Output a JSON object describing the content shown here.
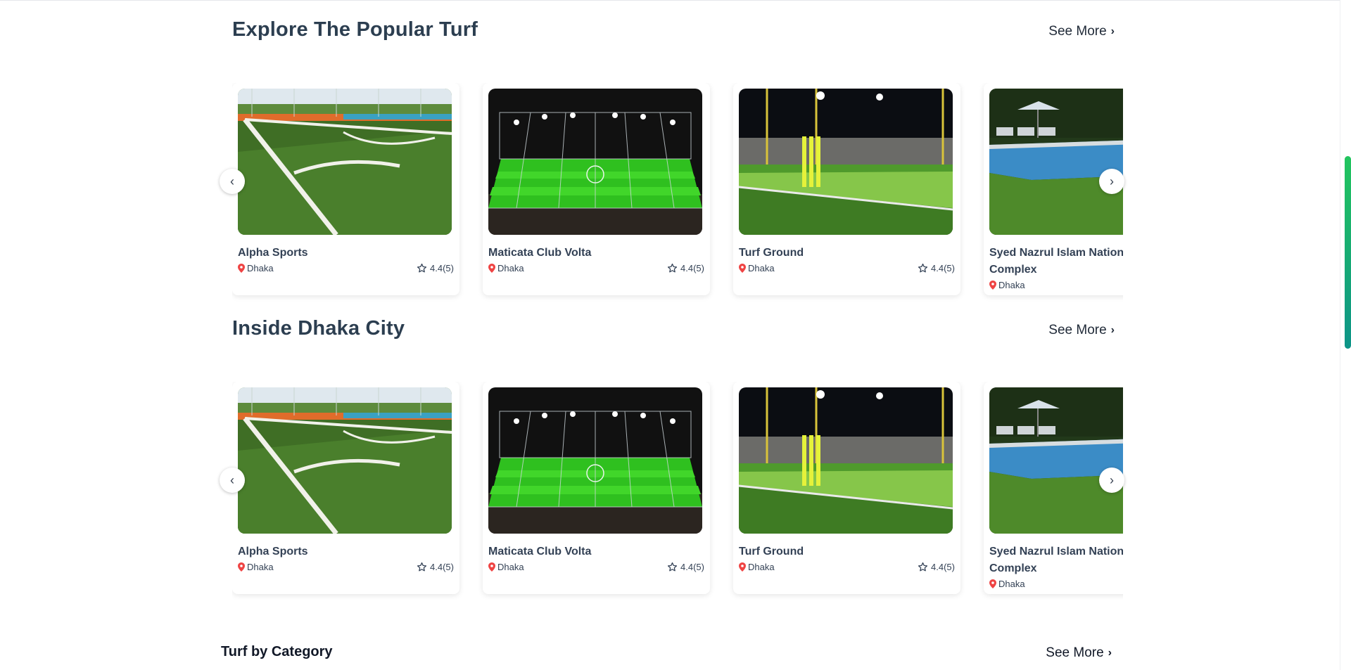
{
  "sections": [
    {
      "title": "Explore The Popular Turf",
      "see_more": "See More",
      "cards": [
        {
          "name": "Alpha Sports",
          "location": "Dhaka",
          "rating": "4.4(5)",
          "image": "soccer-corner-turf"
        },
        {
          "name": "Maticata Club Volta",
          "location": "Dhaka",
          "rating": "4.4(5)",
          "image": "caged-night-turf"
        },
        {
          "name": "Turf Ground",
          "location": "Dhaka",
          "rating": "4.4(5)",
          "image": "cricket-stumps-turf"
        },
        {
          "name": "Syed Nazrul Islam National Complex",
          "location": "Dhaka",
          "rating": "",
          "image": "pool-lawn"
        }
      ]
    },
    {
      "title": "Inside Dhaka City",
      "see_more": "See More",
      "cards": [
        {
          "name": "Alpha Sports",
          "location": "Dhaka",
          "rating": "4.4(5)",
          "image": "soccer-corner-turf"
        },
        {
          "name": "Maticata Club Volta",
          "location": "Dhaka",
          "rating": "4.4(5)",
          "image": "caged-night-turf"
        },
        {
          "name": "Turf Ground",
          "location": "Dhaka",
          "rating": "4.4(5)",
          "image": "cricket-stumps-turf"
        },
        {
          "name": "Syed Nazrul Islam National Complex",
          "location": "Dhaka",
          "rating": "",
          "image": "pool-lawn"
        }
      ]
    }
  ],
  "category": {
    "title": "Turf by Category",
    "see_more": "See More"
  },
  "icons": {
    "prev": "chevron-left-icon",
    "next": "chevron-right-icon",
    "see_more": "chevron-right-icon",
    "pin": "map-pin-icon",
    "star": "star-outline-icon"
  },
  "colors": {
    "pin": "#ef4444",
    "heading": "#2c3e50",
    "scroll_thumb_top": "#22c55e",
    "scroll_thumb_bottom": "#0d9488"
  }
}
